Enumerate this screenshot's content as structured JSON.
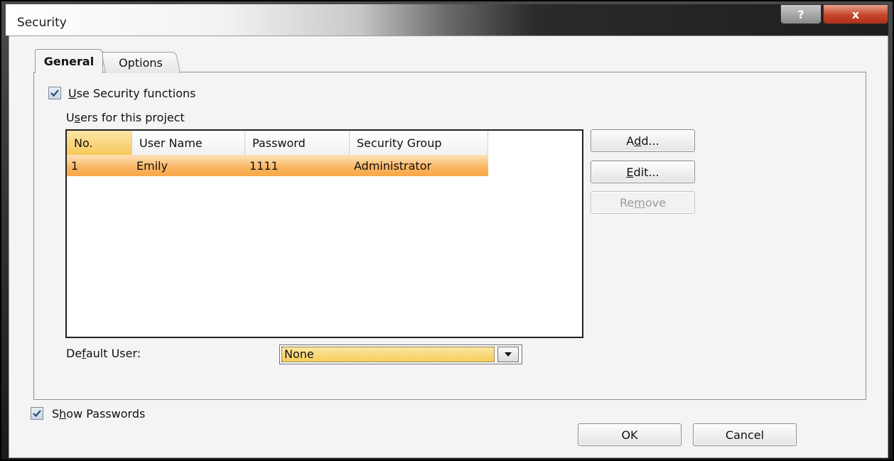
{
  "window": {
    "title": "Security",
    "help_label": "?",
    "close_label": "x"
  },
  "tabs": [
    {
      "label": "General",
      "active": true
    },
    {
      "label": "Options",
      "active": false
    }
  ],
  "general": {
    "use_security": {
      "label_u": "U",
      "label_rest": "se Security functions",
      "checked": true
    },
    "users_label": {
      "pre": "U",
      "u": "s",
      "post": "ers for this project"
    },
    "table": {
      "columns": [
        "No.",
        "User Name",
        "Password",
        "Security Group"
      ],
      "rows": [
        {
          "no": "1",
          "user_name": "Emily",
          "password": "1111",
          "security_group": "Administrator",
          "selected": true
        }
      ]
    },
    "buttons": {
      "add": {
        "pre": "A",
        "u": "d",
        "post": "d..."
      },
      "edit": {
        "pre": "",
        "u": "E",
        "post": "dit..."
      },
      "remove": {
        "pre": "Re",
        "u": "m",
        "post": "ove",
        "disabled": true
      }
    },
    "default_user": {
      "label_pre": "De",
      "label_u": "f",
      "label_post": "ault User:",
      "value": "None"
    }
  },
  "show_passwords": {
    "label_pre": "S",
    "label_u": "h",
    "label_post": "ow Passwords",
    "checked": true
  },
  "footer": {
    "ok": "OK",
    "cancel": "Cancel"
  },
  "colors": {
    "selection": "#fab561",
    "header_sorted": "#f7c95a",
    "combo_highlight": "#f8cd58"
  },
  "annotation": {
    "icon": "arrow-icon"
  }
}
